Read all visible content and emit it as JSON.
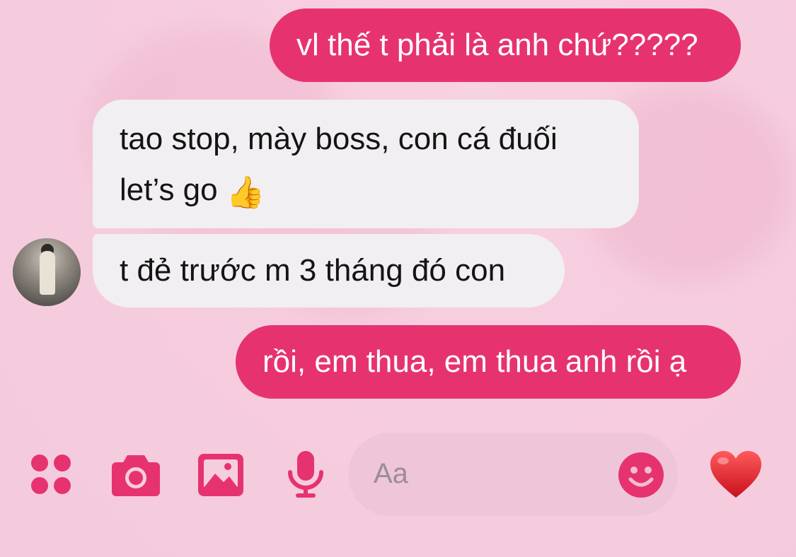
{
  "messages": [
    {
      "direction": "outgoing",
      "text": "vl thế t phải là anh chứ?????"
    },
    {
      "direction": "incoming",
      "line1": "tao stop, mày boss, con cá đuối",
      "line2": "let’s go",
      "emoji": "👍"
    },
    {
      "direction": "incoming",
      "text": "t đẻ trước m 3 tháng đó con"
    },
    {
      "direction": "outgoing",
      "text": "rồi, em thua, em thua anh rồi ạ"
    }
  ],
  "composer": {
    "placeholder": "Aa",
    "icons": [
      "apps-icon",
      "camera-icon",
      "gallery-icon",
      "microphone-icon",
      "emoji-icon",
      "heart-icon"
    ]
  },
  "colors": {
    "accent": "#e6336f",
    "incoming_bubble": "#f1eff1",
    "background": "#f6cddf",
    "input_bg": "#efc5d9"
  }
}
